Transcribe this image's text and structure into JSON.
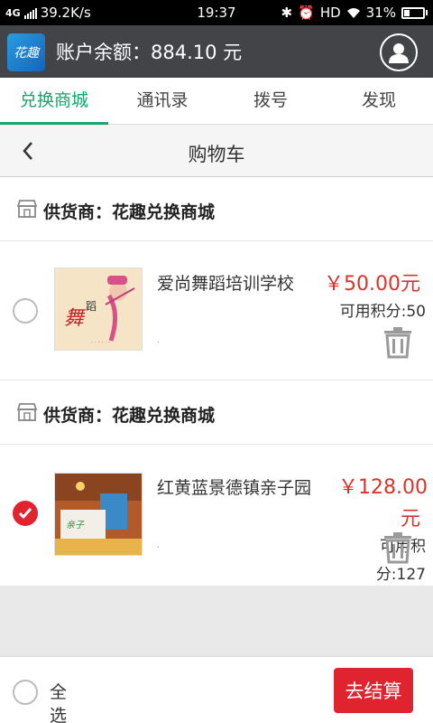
{
  "status_bar": {
    "network": "4G",
    "speed": "39.2K/s",
    "time": "19:37",
    "hd": "HD",
    "battery": "31%",
    "battery_level": 0.31
  },
  "header": {
    "logo_text": "花趣",
    "balance": "账户余额：884.10 元"
  },
  "tabs": [
    {
      "label": "兑换商城",
      "active": true
    },
    {
      "label": "通讯录",
      "active": false
    },
    {
      "label": "拨号",
      "active": false
    },
    {
      "label": "发现",
      "active": false
    }
  ],
  "page": {
    "title": "购物车"
  },
  "cart": [
    {
      "supplier": "供货商：花趣兑换商城",
      "name": "爱尚舞蹈培训学校",
      "price": "￥50.00元",
      "points": "可用积分:50",
      "checked": false,
      "thumb_text": "舞蹈培训中心"
    },
    {
      "supplier": "供货商：花趣兑换商城",
      "name": "红黄蓝景德镇亲子园",
      "price_line1": "￥128.00",
      "price_line2": "元",
      "points_line1": "可用积",
      "points_line2": "分:127",
      "checked": true
    }
  ],
  "bottom": {
    "select_all": "全选",
    "checkout": "去结算"
  },
  "colors": {
    "accent_green": "#1aa36b",
    "price_red": "#d9332b",
    "checkout_red": "#e0242f",
    "header_bg": "#424447"
  }
}
